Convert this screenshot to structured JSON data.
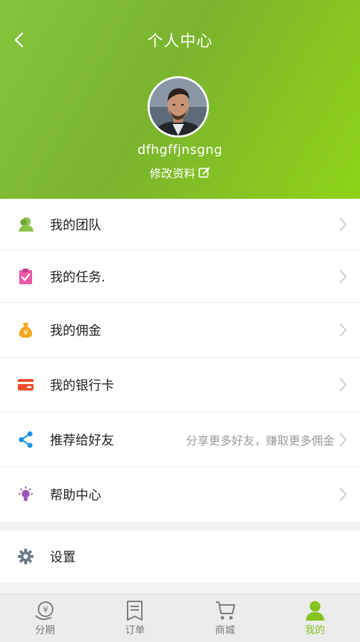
{
  "header": {
    "title": "个人中心",
    "username": "dfhgffjnsgng",
    "edit_profile": "修改资料"
  },
  "menu": [
    {
      "label": "我的团队",
      "icon": "team-icon",
      "hint": ""
    },
    {
      "label": "我的任务.",
      "icon": "task-icon",
      "hint": ""
    },
    {
      "label": "我的佣金",
      "icon": "money-bag-icon",
      "hint": ""
    },
    {
      "label": "我的银行卡",
      "icon": "bank-card-icon",
      "hint": ""
    },
    {
      "label": "推荐给好友",
      "icon": "share-icon",
      "hint": "分享更多好友，赚取更多佣金"
    },
    {
      "label": "帮助中心",
      "icon": "lightbulb-icon",
      "hint": ""
    }
  ],
  "settings": {
    "label": "设置",
    "icon": "gear-icon"
  },
  "tabs": [
    {
      "label": "分期",
      "icon": "installment-icon",
      "active": false
    },
    {
      "label": "订单",
      "icon": "order-icon",
      "active": false
    },
    {
      "label": "商城",
      "icon": "cart-icon",
      "active": false
    },
    {
      "label": "我的",
      "icon": "profile-icon",
      "active": true
    }
  ],
  "colors": {
    "header_gradient_start": "#86c43c",
    "header_gradient_end": "#8fd318",
    "active_tab": "#85c31f",
    "team_icon": "#8bc34a",
    "task_icon": "#ec5aa6",
    "money_icon": "#f5a623",
    "card_icon": "#f04e2a",
    "share_icon": "#1e90e0",
    "help_icon": "#9b59b6",
    "settings_icon": "#6d7a8b"
  }
}
